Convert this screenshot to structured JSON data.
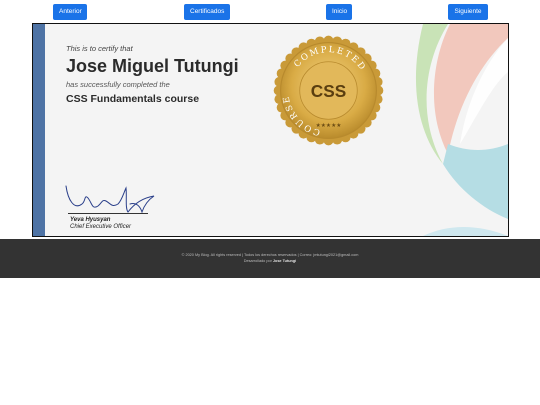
{
  "nav": {
    "prev_label": "Anterior",
    "certs_label": "Certificados",
    "home_label": "Inicio",
    "next_label": "Siguiente",
    "button_color": "#1a73e8"
  },
  "certificate": {
    "intro": "This is to certify that",
    "name": "Jose Miguel Tutungi",
    "completed": "has successfully completed the",
    "course": "CSS Fundamentals course",
    "seal": {
      "top_text": "COMPLETED",
      "bottom_text": "COURSE",
      "center_text": "CSS",
      "stars": "★★★★★"
    },
    "signer": {
      "name": "Yeva Hyusyan",
      "title": "Chief Executive Officer"
    },
    "stripe_color": "#4e73a5"
  },
  "footer": {
    "line1": "© 2020 My Blog. All rights reserved | Todos los derechos reservados | Correo: jmtutungi2021@gmail.com",
    "line2_prefix": "Desarrollado por",
    "line2_author": "Jose Tutungi",
    "background": "#333333"
  }
}
